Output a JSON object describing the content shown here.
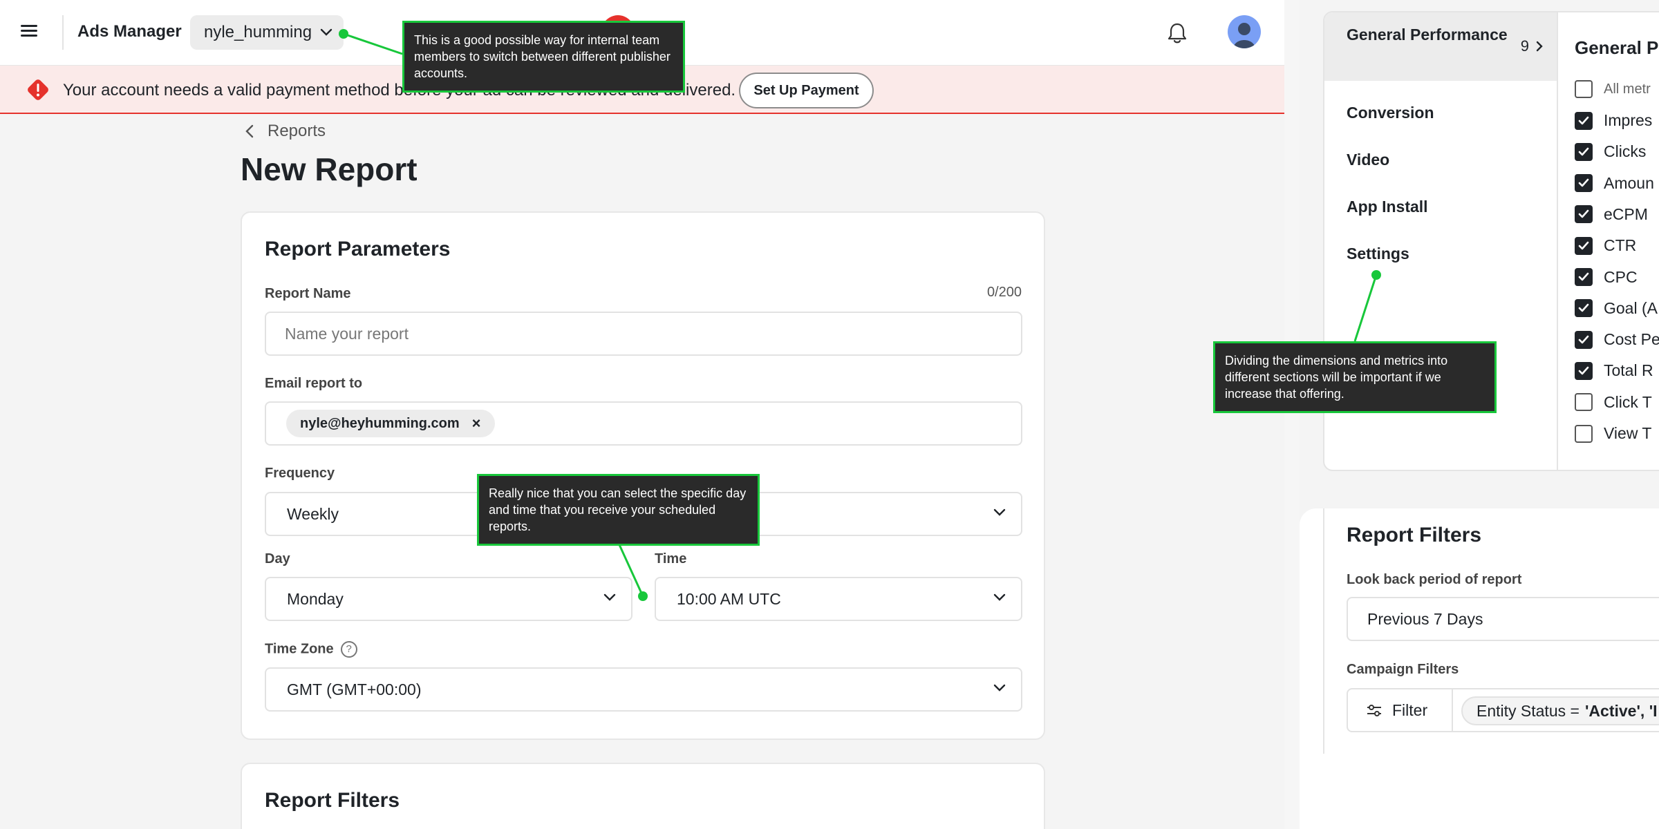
{
  "topbar": {
    "app_title": "Ads Manager",
    "account_name": "nyle_humming",
    "icons": [
      "menu-icon",
      "chevron-down-icon",
      "bell-icon",
      "avatar"
    ]
  },
  "banner": {
    "message": "Your account needs a valid payment method before your ad can be reviewed and delivered.",
    "button": "Set Up Payment",
    "color": "#e5322c"
  },
  "breadcrumb": {
    "label": "Reports"
  },
  "page_title": "New Report",
  "params": {
    "title": "Report Parameters",
    "report_name_label": "Report Name",
    "report_name_counter": "0/200",
    "report_name_placeholder": "Name your report",
    "email_label": "Email report to",
    "email_chip": "nyle@heyhumming.com",
    "email_chip_remove": "×",
    "frequency_label": "Frequency",
    "frequency_value": "Weekly",
    "day_label": "Day",
    "day_value": "Monday",
    "time_label": "Time",
    "time_value": "10:00 AM UTC",
    "timezone_label": "Time Zone",
    "timezone_help": "?",
    "timezone_value": "GMT (GMT+00:00)"
  },
  "filters_left": {
    "title": "Report Filters"
  },
  "metrics": {
    "categories": [
      {
        "label": "General Performance",
        "count": "9"
      },
      {
        "label": "Conversion"
      },
      {
        "label": "Video"
      },
      {
        "label": "App Install"
      },
      {
        "label": "Settings"
      }
    ],
    "column_title": "General Pe",
    "all_label": "All metr",
    "items": [
      {
        "label": "Impres",
        "checked": true
      },
      {
        "label": "Clicks",
        "checked": true
      },
      {
        "label": "Amoun",
        "checked": true
      },
      {
        "label": "eCPM",
        "checked": true
      },
      {
        "label": "CTR",
        "checked": true
      },
      {
        "label": "CPC",
        "checked": true
      },
      {
        "label": "Goal (A",
        "checked": true
      },
      {
        "label": "Cost Pe",
        "checked": true
      },
      {
        "label": "Total R",
        "checked": true
      },
      {
        "label": "Click T",
        "checked": false
      },
      {
        "label": "View T",
        "checked": false
      }
    ]
  },
  "filters_right": {
    "title": "Report Filters",
    "lookback_label": "Look back period of report",
    "lookback_value": "Previous 7 Days",
    "campaign_label": "Campaign Filters",
    "filter_button": "Filter",
    "chip_prefix": "Entity Status =",
    "chip_value": "'Active', 'I"
  },
  "annotations": {
    "accounts": "This is a good possible way for internal team members to switch between different publisher accounts.",
    "schedule": "Really nice that you can select the specific day and time that you receive your scheduled reports.",
    "sections": "Dividing the dimensions and metrics into different sections will be important if we increase that offering."
  },
  "colors": {
    "annotation_border": "#18c73b",
    "annotation_bg": "#2a2a2a",
    "checkbox": "#1f2328"
  }
}
